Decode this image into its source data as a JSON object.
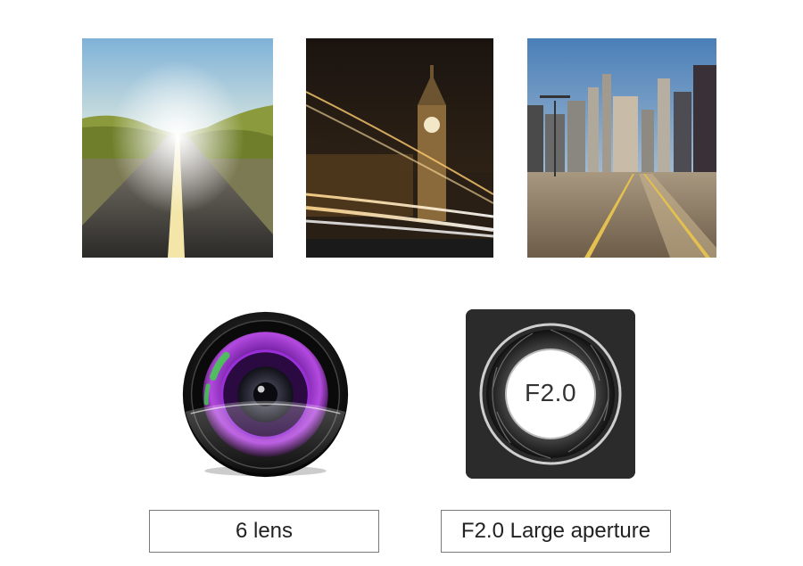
{
  "photos": [
    {
      "name": "road-sunset-photo"
    },
    {
      "name": "clock-tower-night-photo"
    },
    {
      "name": "city-street-photo"
    }
  ],
  "lens": {
    "icon": "camera-lens-icon"
  },
  "aperture": {
    "icon": "aperture-icon",
    "value_text": "F2.0"
  },
  "labels": {
    "lens_label": "6 lens",
    "aperture_label": "F2.0 Large aperture"
  },
  "colors": {
    "lens_purple": "#9b30d9",
    "lens_green": "#3fd24a",
    "aperture_bg": "#2b2b2b",
    "label_border": "#7a7a7a"
  }
}
